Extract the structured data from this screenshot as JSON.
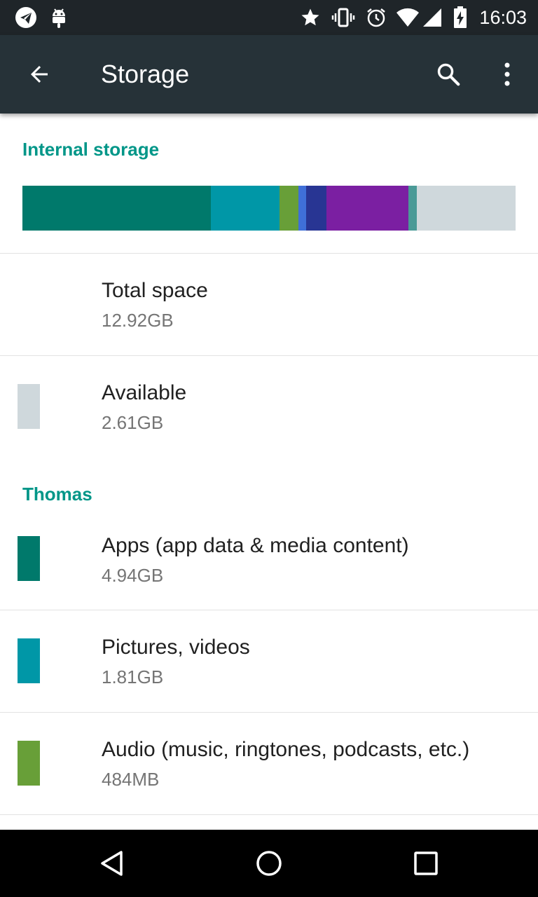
{
  "status_bar": {
    "time": "16:03",
    "left_icons": [
      "telegram-icon",
      "android-debug-icon"
    ],
    "right_icons": [
      "star-icon",
      "vibrate-icon",
      "alarm-icon",
      "wifi-icon",
      "cell-signal-icon",
      "battery-charging-icon"
    ]
  },
  "toolbar": {
    "title": "Storage",
    "back_icon": "arrow-back-icon",
    "search_icon": "search-icon",
    "more_icon": "more-vert-icon"
  },
  "internal_storage": {
    "header": "Internal storage",
    "bar_segments": [
      {
        "name": "apps",
        "fraction": 0.382,
        "color": "#00796b"
      },
      {
        "name": "pictures",
        "fraction": 0.14,
        "color": "#0097a7"
      },
      {
        "name": "audio",
        "fraction": 0.037,
        "color": "#689f38"
      },
      {
        "name": "downloads",
        "fraction": 0.017,
        "color": "#3f6fd8"
      },
      {
        "name": "cached",
        "fraction": 0.041,
        "color": "#283593"
      },
      {
        "name": "misc",
        "fraction": 0.166,
        "color": "#7b1fa2"
      },
      {
        "name": "other",
        "fraction": 0.017,
        "color": "#4a9a97"
      },
      {
        "name": "available",
        "fraction": 0.2,
        "color": "#cfd8dc"
      }
    ]
  },
  "total_space": {
    "title": "Total space",
    "value": "12.92GB"
  },
  "available": {
    "title": "Available",
    "value": "2.61GB",
    "color": "#cfd8dc"
  },
  "user_section": {
    "header": "Thomas",
    "items": [
      {
        "title": "Apps (app data & media content)",
        "value": "4.94GB",
        "color": "#00796b"
      },
      {
        "title": "Pictures, videos",
        "value": "1.81GB",
        "color": "#0097a7"
      },
      {
        "title": "Audio (music, ringtones, podcasts, etc.)",
        "value": "484MB",
        "color": "#689f38"
      }
    ]
  },
  "nav_bar": {
    "back_icon": "nav-back-icon",
    "home_icon": "nav-home-icon",
    "recents_icon": "nav-recents-icon"
  }
}
